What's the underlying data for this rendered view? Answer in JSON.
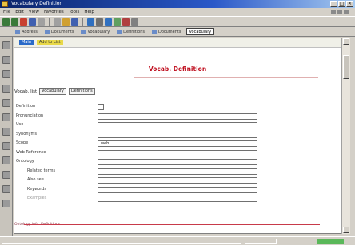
{
  "window": {
    "title": "Vocabulary Definition"
  },
  "menubar": {
    "items": [
      "File",
      "Edit",
      "View",
      "Favorites",
      "Tools",
      "Help"
    ]
  },
  "toolbar": {
    "icon_colors": [
      "#3a7a3a",
      "#3a7a3a",
      "#c84030",
      "#4060b0",
      "#a0a0a0",
      "#a0a0a0",
      "#d0a030",
      "#4060b0",
      "#3070c0",
      "#707070",
      "#3070c0",
      "#60a060",
      "#b04040",
      "#808080"
    ]
  },
  "tabs": {
    "items": [
      "Address",
      "Documents",
      "Vocabulary",
      "Definitions",
      "Documents",
      "Vocabulary"
    ]
  },
  "content": {
    "header_button": "Main",
    "header_link": "Add to List",
    "title": "Vocab. Definition",
    "view_label": "Vocab. list",
    "view_btn1": "Vocabulary",
    "view_btn2": "Definitions",
    "labels": {
      "l1": "Definition",
      "l2": "Pronunciation",
      "l3": "Use",
      "l4": "Synonyms",
      "l5": "Scope",
      "l6": "Web Reference",
      "l7": "Ontology",
      "l8": "Related terms",
      "l9": "Also see",
      "l10": "Keywords",
      "l11": "Examples"
    },
    "scope_value": "web",
    "bottom_text": "Ontology info. Definitions"
  }
}
